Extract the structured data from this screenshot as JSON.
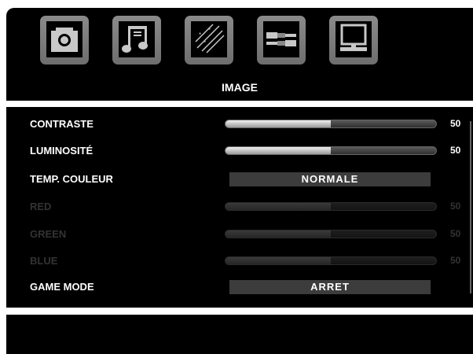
{
  "tabs": [
    {
      "icon": "camera-icon"
    },
    {
      "icon": "music-note-icon"
    },
    {
      "icon": "sparkle-icon"
    },
    {
      "icon": "cable-connectors-icon"
    },
    {
      "icon": "monitor-icon"
    }
  ],
  "header": {
    "title": "IMAGE"
  },
  "settings": {
    "contraste": {
      "label": "CONTRASTE",
      "value": "50",
      "level_pct": 50
    },
    "luminosite": {
      "label": "LUMINOSITÉ",
      "value": "50",
      "level_pct": 50
    },
    "temp_couleur": {
      "label": "TEMP. COULEUR",
      "value": "NORMALE"
    },
    "red": {
      "label": "RED",
      "value": "50",
      "level_pct": 50
    },
    "green": {
      "label": "GREEN",
      "value": "50",
      "level_pct": 50
    },
    "blue": {
      "label": "BLUE",
      "value": "50",
      "level_pct": 50
    },
    "game_mode": {
      "label": "GAME MODE",
      "value": "ARRET"
    }
  },
  "colors": {
    "panel": "#000000",
    "tab": "#7a7a7a",
    "disabled_text": "#333333"
  }
}
